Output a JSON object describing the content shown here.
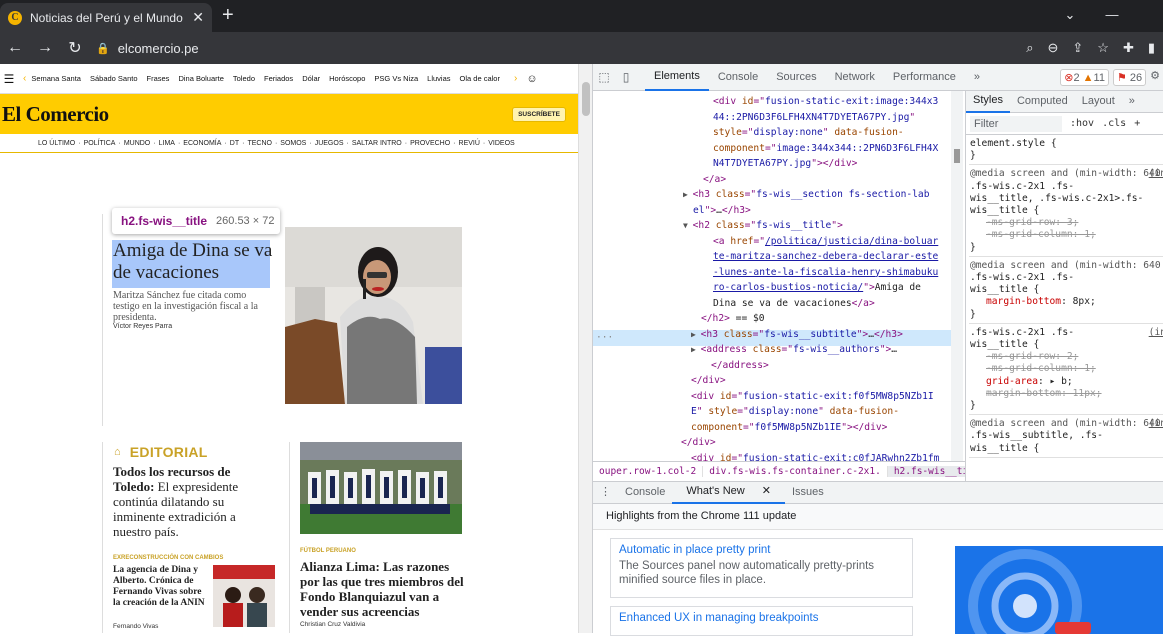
{
  "browser": {
    "tab_title": "Noticias del Perú y el Mundo de",
    "url": "elcomercio.pe"
  },
  "site": {
    "section_nav": [
      "Semana Santa",
      "Sábado Santo",
      "Frases",
      "Dina Boluarte",
      "Toledo",
      "Feriados",
      "Dólar",
      "Horóscopo",
      "PSG Vs Niza",
      "Lluvias",
      "Ola de calor"
    ],
    "logo": "El Comercio",
    "subscribe": "SUSCRÍBETE",
    "menu": [
      "LO ÚLTIMO",
      "POLÍTICA",
      "MUNDO",
      "LIMA",
      "ECONOMÍA",
      "DT",
      "TECNO",
      "SOMOS",
      "JUEGOS",
      "SALTAR INTRO",
      "PROVECHO",
      "REVIÚ",
      "VIDEOS"
    ],
    "tooltip": {
      "selector": "h2.fs-wis__title",
      "size": "260.53 × 72"
    },
    "lead": {
      "title": "Amiga de Dina se va de vacaciones",
      "summary": "Maritza Sánchez fue citada como testigo en la investigación fiscal a la presidenta.",
      "author": "Víctor Reyes Parra"
    },
    "editorial": {
      "label": "EDITORIAL",
      "title_bold": "Todos los recursos de Toledo:",
      "title_rest": " El expresidente continúa dilatando su inminente extradición a nuestro país."
    },
    "story3": {
      "kicker": "EXRECONSTRUCCIÓN CON CAMBIOS",
      "title": "La agencia de Dina y Alberto. Crónica de Fernando Vivas sobre la creación de la ANIN",
      "author": "Fernando Vivas"
    },
    "story4": {
      "kicker": "FÚTBOL PERUANO",
      "title": "Alianza Lima: Las razones por las que tres miembros del Fondo Blanquiazul van a vender sus acreencias",
      "author": "Christian Cruz Valdivia"
    }
  },
  "devtools": {
    "tabs": [
      "Elements",
      "Console",
      "Sources",
      "Network",
      "Performance"
    ],
    "badges": {
      "errors": "2",
      "warnings": "11",
      "issues": "26"
    },
    "elements_lines": [
      {
        "parts": [
          [
            "tg",
            "<div "
          ],
          [
            "an",
            "id"
          ],
          [
            "tg",
            "=\""
          ],
          [
            "av",
            "fusion-static-exit:image:344x3"
          ]
        ]
      },
      {
        "parts": [
          [
            "av",
            "44::2PN6D3F6LFH4XN4T7DYETA67PY.jpg"
          ],
          [
            "tg",
            "\""
          ]
        ]
      },
      {
        "parts": [
          [
            "an",
            "style"
          ],
          [
            "tg",
            "=\""
          ],
          [
            "av",
            "display:none"
          ],
          [
            "tg",
            "\" "
          ],
          [
            "an",
            "data-fusion-"
          ]
        ]
      },
      {
        "parts": [
          [
            "an",
            "component"
          ],
          [
            "tg",
            "=\""
          ],
          [
            "av",
            "image:344x344::2PN6D3F6LFH4X"
          ]
        ]
      },
      {
        "parts": [
          [
            "av",
            "N4T7DYETA67PY.jpg"
          ],
          [
            "tg",
            "\"></div>"
          ]
        ]
      },
      {
        "parts": [
          [
            "tg",
            "</a>"
          ]
        ]
      },
      {
        "parts": [
          [
            "tg",
            "<h3 "
          ],
          [
            "an",
            "class"
          ],
          [
            "tg",
            "=\""
          ],
          [
            "av",
            "fs-wis__section fs-section-lab"
          ]
        ]
      },
      {
        "parts": [
          [
            "av",
            "el"
          ],
          [
            "tg",
            "\">"
          ],
          [
            "tx",
            "…"
          ],
          [
            "tg",
            "</h3>"
          ]
        ]
      },
      {
        "parts": [
          [
            "tg",
            "<h2 "
          ],
          [
            "an",
            "class"
          ],
          [
            "tg",
            "=\""
          ],
          [
            "av",
            "fs-wis__title"
          ],
          [
            "tg",
            "\">"
          ]
        ]
      },
      {
        "parts": [
          [
            "tg",
            "<a "
          ],
          [
            "an",
            "href"
          ],
          [
            "tg",
            "=\""
          ],
          [
            "lk",
            "/politica/justicia/dina-boluar"
          ]
        ]
      },
      {
        "parts": [
          [
            "lk",
            "te-maritza-sanchez-debera-declarar-este"
          ]
        ]
      },
      {
        "parts": [
          [
            "lk",
            "-lunes-ante-la-fiscalia-henry-shimabuku"
          ]
        ]
      },
      {
        "parts": [
          [
            "lk",
            "ro-carlos-bustios-noticia/"
          ],
          [
            "tg",
            "\">"
          ],
          [
            "tx",
            "Amiga de"
          ]
        ]
      },
      {
        "parts": [
          [
            "tx",
            "Dina se va de vacaciones"
          ],
          [
            "tg",
            "</a>"
          ]
        ]
      },
      {
        "parts": [
          [
            "tg",
            "</h2>"
          ],
          [
            "tx",
            " == $0"
          ]
        ]
      },
      {
        "parts": [
          [
            "tg",
            "<h3 "
          ],
          [
            "an",
            "class"
          ],
          [
            "tg",
            "=\""
          ],
          [
            "av",
            "fs-wis__subtitle"
          ],
          [
            "tg",
            "\">"
          ],
          [
            "tx",
            "…"
          ],
          [
            "tg",
            "</h3>"
          ]
        ]
      },
      {
        "parts": [
          [
            "tg",
            "<address "
          ],
          [
            "an",
            "class"
          ],
          [
            "tg",
            "=\""
          ],
          [
            "av",
            "fs-wis__authors"
          ],
          [
            "tg",
            "\">"
          ],
          [
            "tx",
            "…"
          ]
        ]
      },
      {
        "parts": [
          [
            "tg",
            "</address>"
          ]
        ]
      },
      {
        "parts": [
          [
            "tg",
            "</div>"
          ]
        ]
      },
      {
        "parts": [
          [
            "tg",
            "<div "
          ],
          [
            "an",
            "id"
          ],
          [
            "tg",
            "=\""
          ],
          [
            "av",
            "fusion-static-exit:f0f5MW8p5NZb1I"
          ]
        ]
      },
      {
        "parts": [
          [
            "av",
            "E"
          ],
          [
            "tg",
            "\" "
          ],
          [
            "an",
            "style"
          ],
          [
            "tg",
            "=\""
          ],
          [
            "av",
            "display:none"
          ],
          [
            "tg",
            "\" "
          ],
          [
            "an",
            "data-fusion-"
          ]
        ]
      },
      {
        "parts": [
          [
            "an",
            "component"
          ],
          [
            "tg",
            "=\""
          ],
          [
            "av",
            "f0f5MW8p5NZb1IE"
          ],
          [
            "tg",
            "\"></div>"
          ]
        ]
      },
      {
        "parts": [
          [
            "tg",
            "</div>"
          ]
        ]
      },
      {
        "parts": [
          [
            "tg",
            "<div "
          ],
          [
            "an",
            "id"
          ],
          [
            "tg",
            "=\""
          ],
          [
            "av",
            "fusion-static-exit:c0fJARwhn2Zb1fm"
          ]
        ]
      }
    ],
    "breadcrumbs": [
      "ouper.row-1.col-2",
      "div.fs-wis.fs-container.c-2x1.",
      "h2.fs-wis__title"
    ],
    "styles_tabs": [
      "Styles",
      "Computed",
      "Layout"
    ],
    "filter_placeholder": "Filter",
    "filter_ops": [
      ":hov",
      ".cls",
      "+"
    ],
    "drawer_tabs": [
      "Console",
      "What's New",
      "Issues"
    ],
    "drawer_heading": "Highlights from the Chrome 111 update",
    "cards": [
      {
        "title": "Automatic in place pretty print",
        "desc": "The Sources panel now automatically pretty-prints minified source files in place."
      },
      {
        "title": "Enhanced UX in managing breakpoints",
        "desc": ""
      }
    ]
  }
}
